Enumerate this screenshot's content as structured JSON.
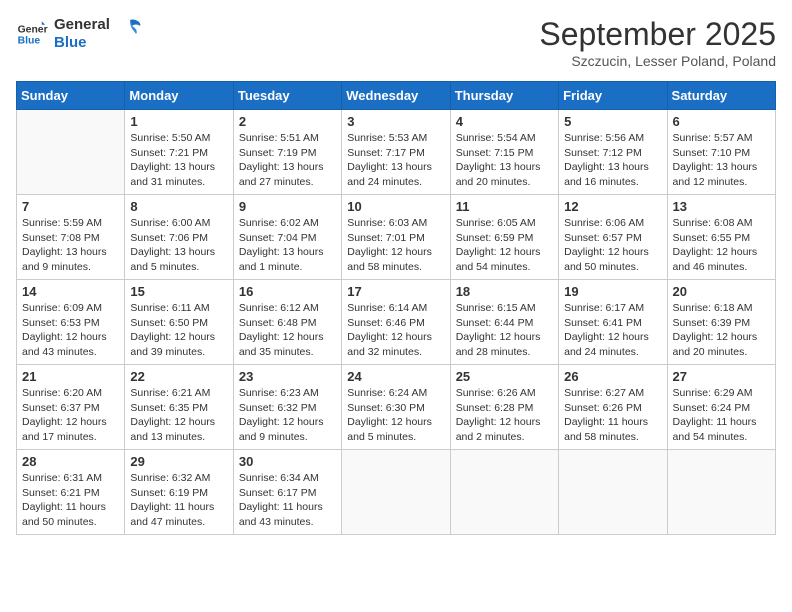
{
  "header": {
    "logo": {
      "line1": "General",
      "line2": "Blue"
    },
    "title": "September 2025",
    "subtitle": "Szczucin, Lesser Poland, Poland"
  },
  "weekdays": [
    "Sunday",
    "Monday",
    "Tuesday",
    "Wednesday",
    "Thursday",
    "Friday",
    "Saturday"
  ],
  "weeks": [
    [
      {
        "day": null
      },
      {
        "day": 1,
        "sunrise": "5:50 AM",
        "sunset": "7:21 PM",
        "daylight": "13 hours and 31 minutes."
      },
      {
        "day": 2,
        "sunrise": "5:51 AM",
        "sunset": "7:19 PM",
        "daylight": "13 hours and 27 minutes."
      },
      {
        "day": 3,
        "sunrise": "5:53 AM",
        "sunset": "7:17 PM",
        "daylight": "13 hours and 24 minutes."
      },
      {
        "day": 4,
        "sunrise": "5:54 AM",
        "sunset": "7:15 PM",
        "daylight": "13 hours and 20 minutes."
      },
      {
        "day": 5,
        "sunrise": "5:56 AM",
        "sunset": "7:12 PM",
        "daylight": "13 hours and 16 minutes."
      },
      {
        "day": 6,
        "sunrise": "5:57 AM",
        "sunset": "7:10 PM",
        "daylight": "13 hours and 12 minutes."
      }
    ],
    [
      {
        "day": 7,
        "sunrise": "5:59 AM",
        "sunset": "7:08 PM",
        "daylight": "13 hours and 9 minutes."
      },
      {
        "day": 8,
        "sunrise": "6:00 AM",
        "sunset": "7:06 PM",
        "daylight": "13 hours and 5 minutes."
      },
      {
        "day": 9,
        "sunrise": "6:02 AM",
        "sunset": "7:04 PM",
        "daylight": "13 hours and 1 minute."
      },
      {
        "day": 10,
        "sunrise": "6:03 AM",
        "sunset": "7:01 PM",
        "daylight": "12 hours and 58 minutes."
      },
      {
        "day": 11,
        "sunrise": "6:05 AM",
        "sunset": "6:59 PM",
        "daylight": "12 hours and 54 minutes."
      },
      {
        "day": 12,
        "sunrise": "6:06 AM",
        "sunset": "6:57 PM",
        "daylight": "12 hours and 50 minutes."
      },
      {
        "day": 13,
        "sunrise": "6:08 AM",
        "sunset": "6:55 PM",
        "daylight": "12 hours and 46 minutes."
      }
    ],
    [
      {
        "day": 14,
        "sunrise": "6:09 AM",
        "sunset": "6:53 PM",
        "daylight": "12 hours and 43 minutes."
      },
      {
        "day": 15,
        "sunrise": "6:11 AM",
        "sunset": "6:50 PM",
        "daylight": "12 hours and 39 minutes."
      },
      {
        "day": 16,
        "sunrise": "6:12 AM",
        "sunset": "6:48 PM",
        "daylight": "12 hours and 35 minutes."
      },
      {
        "day": 17,
        "sunrise": "6:14 AM",
        "sunset": "6:46 PM",
        "daylight": "12 hours and 32 minutes."
      },
      {
        "day": 18,
        "sunrise": "6:15 AM",
        "sunset": "6:44 PM",
        "daylight": "12 hours and 28 minutes."
      },
      {
        "day": 19,
        "sunrise": "6:17 AM",
        "sunset": "6:41 PM",
        "daylight": "12 hours and 24 minutes."
      },
      {
        "day": 20,
        "sunrise": "6:18 AM",
        "sunset": "6:39 PM",
        "daylight": "12 hours and 20 minutes."
      }
    ],
    [
      {
        "day": 21,
        "sunrise": "6:20 AM",
        "sunset": "6:37 PM",
        "daylight": "12 hours and 17 minutes."
      },
      {
        "day": 22,
        "sunrise": "6:21 AM",
        "sunset": "6:35 PM",
        "daylight": "12 hours and 13 minutes."
      },
      {
        "day": 23,
        "sunrise": "6:23 AM",
        "sunset": "6:32 PM",
        "daylight": "12 hours and 9 minutes."
      },
      {
        "day": 24,
        "sunrise": "6:24 AM",
        "sunset": "6:30 PM",
        "daylight": "12 hours and 5 minutes."
      },
      {
        "day": 25,
        "sunrise": "6:26 AM",
        "sunset": "6:28 PM",
        "daylight": "12 hours and 2 minutes."
      },
      {
        "day": 26,
        "sunrise": "6:27 AM",
        "sunset": "6:26 PM",
        "daylight": "11 hours and 58 minutes."
      },
      {
        "day": 27,
        "sunrise": "6:29 AM",
        "sunset": "6:24 PM",
        "daylight": "11 hours and 54 minutes."
      }
    ],
    [
      {
        "day": 28,
        "sunrise": "6:31 AM",
        "sunset": "6:21 PM",
        "daylight": "11 hours and 50 minutes."
      },
      {
        "day": 29,
        "sunrise": "6:32 AM",
        "sunset": "6:19 PM",
        "daylight": "11 hours and 47 minutes."
      },
      {
        "day": 30,
        "sunrise": "6:34 AM",
        "sunset": "6:17 PM",
        "daylight": "11 hours and 43 minutes."
      },
      {
        "day": null
      },
      {
        "day": null
      },
      {
        "day": null
      },
      {
        "day": null
      }
    ]
  ],
  "labels": {
    "sunrise": "Sunrise:",
    "sunset": "Sunset:",
    "daylight": "Daylight:"
  }
}
